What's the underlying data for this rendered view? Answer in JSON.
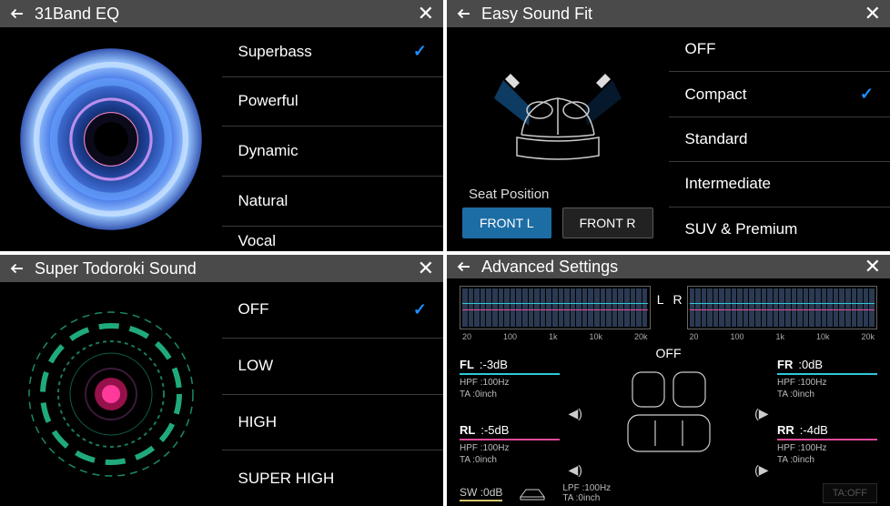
{
  "panels": {
    "eq": {
      "title": "31Band EQ",
      "items": [
        {
          "label": "Superbass",
          "selected": true
        },
        {
          "label": "Powerful",
          "selected": false
        },
        {
          "label": "Dynamic",
          "selected": false
        },
        {
          "label": "Natural",
          "selected": false
        },
        {
          "label": "Vocal",
          "selected": false
        }
      ]
    },
    "easyfit": {
      "title": "Easy Sound Fit",
      "seat_label": "Seat Position",
      "seat_options": [
        "FRONT L",
        "FRONT R"
      ],
      "seat_selected": "FRONT L",
      "items": [
        {
          "label": "OFF",
          "selected": false
        },
        {
          "label": "Compact",
          "selected": true
        },
        {
          "label": "Standard",
          "selected": false
        },
        {
          "label": "Intermediate",
          "selected": false
        },
        {
          "label": "SUV & Premium",
          "selected": false
        }
      ]
    },
    "todoroki": {
      "title": "Super Todoroki Sound",
      "items": [
        {
          "label": "OFF",
          "selected": true
        },
        {
          "label": "LOW",
          "selected": false
        },
        {
          "label": "HIGH",
          "selected": false
        },
        {
          "label": "SUPER HIGH",
          "selected": false
        }
      ]
    },
    "advanced": {
      "title": "Advanced Settings",
      "spectrum": {
        "left_label": "L",
        "right_label": "R",
        "ticks": [
          "20",
          "100",
          "1k",
          "10k",
          "20k"
        ]
      },
      "center_label": "OFF",
      "channels": {
        "fl": {
          "name": "FL",
          "level": ":-3dB",
          "hpf": "HPF  :100Hz",
          "ta": "TA    :0inch"
        },
        "fr": {
          "name": "FR",
          "level": ":0dB",
          "hpf": "HPF  :100Hz",
          "ta": "TA    :0inch"
        },
        "rl": {
          "name": "RL",
          "level": ":-5dB",
          "hpf": "HPF  :100Hz",
          "ta": "TA    :0inch"
        },
        "rr": {
          "name": "RR",
          "level": ":-4dB",
          "hpf": "HPF  :100Hz",
          "ta": "TA    :0inch"
        }
      },
      "sw": {
        "name": "SW",
        "level": ":0dB"
      },
      "lpf": {
        "lpf": "LPF  :100Hz",
        "ta": "TA    :0inch"
      },
      "ta_button": "TA:OFF",
      "colors": {
        "cyan": "#2fc7d6",
        "magenta": "#e04a9b",
        "yellow": "#d6c46a",
        "accent_blue": "#1f8fff"
      }
    }
  }
}
